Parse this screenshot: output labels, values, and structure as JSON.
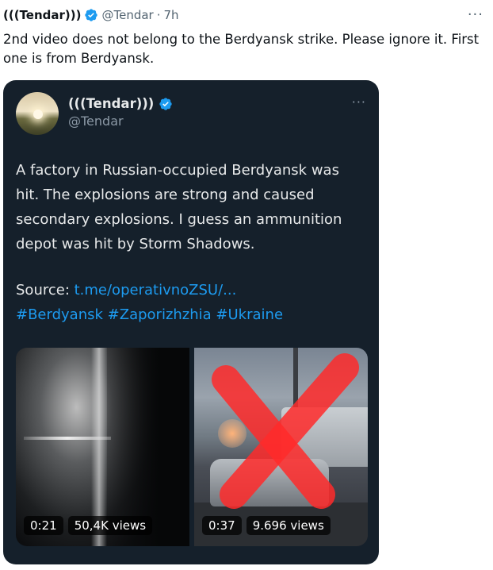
{
  "outer_tweet": {
    "display_name": "(((Tendar)))",
    "handle": "@Tendar",
    "separator": "·",
    "time": "7h",
    "more": "···",
    "text": "2nd video does not belong to the Berdyansk strike. Please ignore it. First one is from Berdyansk."
  },
  "quoted_tweet": {
    "display_name": "(((Tendar)))",
    "handle": "@Tendar",
    "more": "···",
    "text": "A factory in Russian-occupied Berdyansk was hit. The explosions are strong and caused secondary explosions. I guess an ammunition depot was hit by Storm Shadows.",
    "source_label": "Source: ",
    "source_link": "t.me/operativnoZSU/...",
    "hashtags": [
      "#Berdyansk",
      "#Zaporizhzhia",
      "#Ukraine"
    ],
    "videos": [
      {
        "duration": "0:21",
        "views": "50,4K views"
      },
      {
        "duration": "0:37",
        "views": "9.696 views"
      }
    ]
  },
  "colors": {
    "verified": "#1d9bf0",
    "link": "#1d9bf0",
    "card_bg": "#15202b",
    "x_mark": "#ff2a2a"
  },
  "icons": [
    "verified-badge-icon",
    "more-icon",
    "red-x-icon"
  ]
}
